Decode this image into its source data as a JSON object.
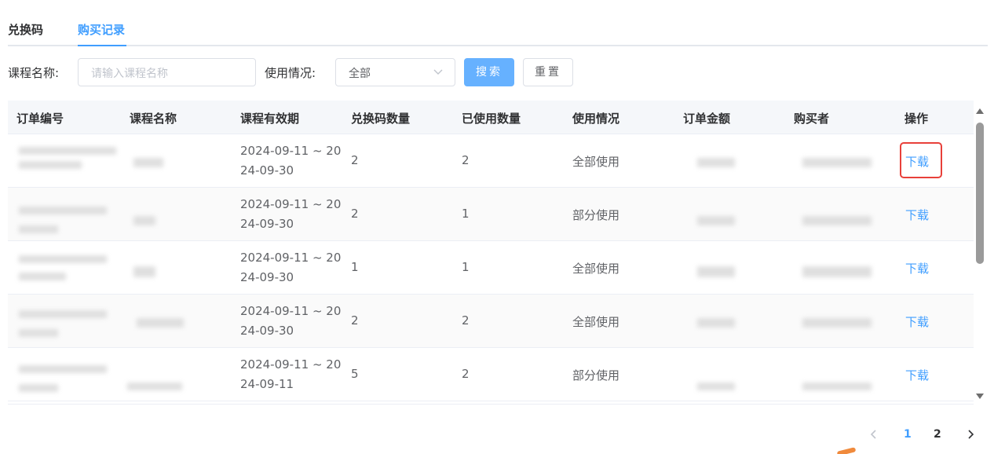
{
  "tabs": {
    "items": [
      "兑换码",
      "购买记录"
    ],
    "active": 1
  },
  "filter": {
    "course_label": "课程名称:",
    "course_placeholder": "请输入课程名称",
    "usage_label": "使用情况:",
    "usage_value": "全部",
    "search_label": "搜索",
    "reset_label": "重置"
  },
  "table": {
    "columns": [
      "订单编号",
      "课程名称",
      "课程有效期",
      "兑换码数量",
      "已使用数量",
      "使用情况",
      "订单金额",
      "购买者",
      "操作"
    ],
    "rows": [
      {
        "period_line1": "2024-09-11 ~ 20",
        "period_line2": "24-09-30",
        "code_count": "2",
        "used_count": "2",
        "usage": "全部使用",
        "action": "下载"
      },
      {
        "period_line1": "2024-09-11 ~ 20",
        "period_line2": "24-09-30",
        "code_count": "2",
        "used_count": "1",
        "usage": "部分使用",
        "action": "下载"
      },
      {
        "period_line1": "2024-09-11 ~ 20",
        "period_line2": "24-09-30",
        "code_count": "1",
        "used_count": "1",
        "usage": "全部使用",
        "action": "下载"
      },
      {
        "period_line1": "2024-09-11 ~ 20",
        "period_line2": "24-09-30",
        "code_count": "2",
        "used_count": "2",
        "usage": "全部使用",
        "action": "下载"
      },
      {
        "period_line1": "2024-09-11 ~ 20",
        "period_line2": "24-09-11",
        "code_count": "5",
        "used_count": "2",
        "usage": "部分使用",
        "action": "下载"
      }
    ]
  },
  "pagination": {
    "pages": [
      "1",
      "2"
    ],
    "current": "1"
  },
  "colors": {
    "accent": "#409eff",
    "highlight_box": "#e8403a",
    "primary_button": "#66b1ff"
  },
  "icons": [
    "chevron-down-icon",
    "prev-page-icon",
    "next-page-icon",
    "scroll-up-icon",
    "scroll-down-icon"
  ]
}
